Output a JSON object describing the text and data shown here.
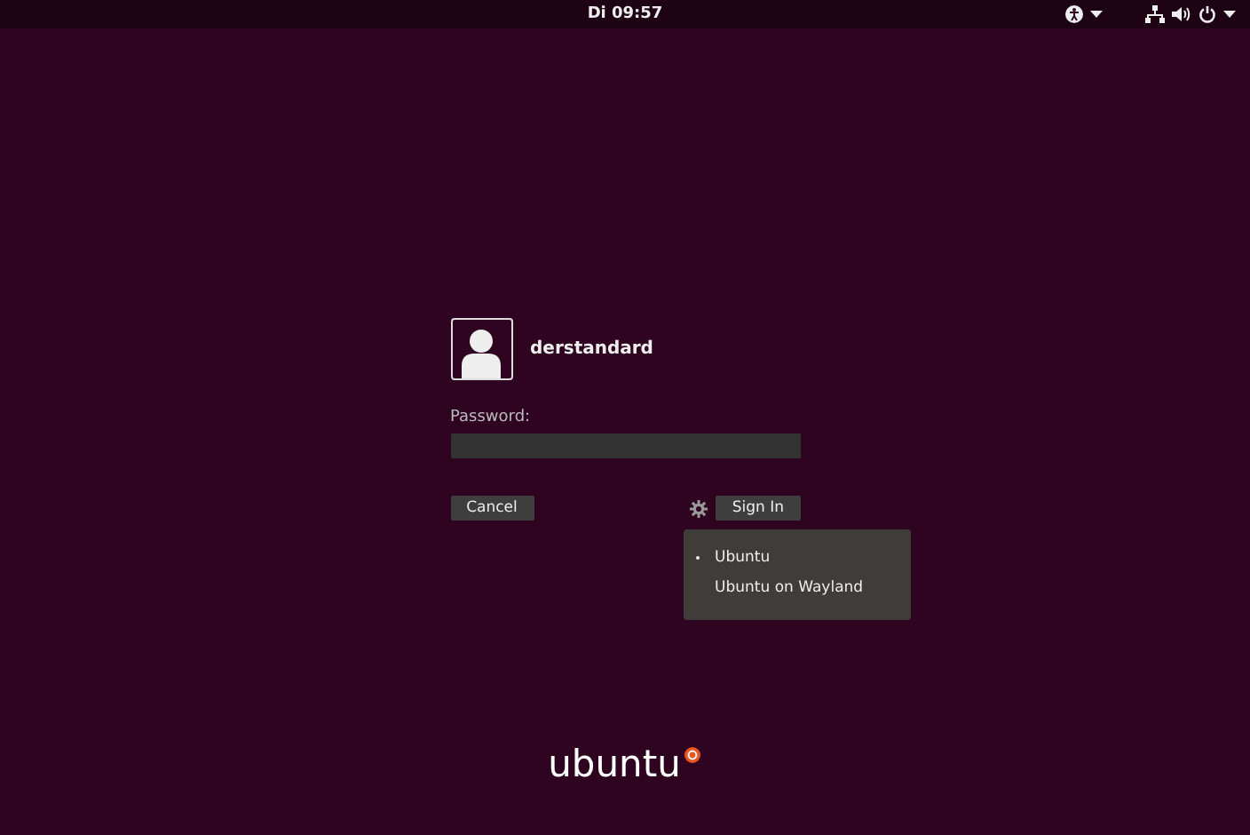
{
  "top_bar": {
    "clock": "Di 09:57"
  },
  "login": {
    "username": "derstandard",
    "password_label": "Password:",
    "cancel": "Cancel",
    "sign_in": "Sign In"
  },
  "session_menu": {
    "items": [
      {
        "label": "Ubuntu",
        "selected": true
      },
      {
        "label": "Ubuntu on Wayland",
        "selected": false
      }
    ]
  },
  "logo": {
    "text": "ubuntu"
  }
}
